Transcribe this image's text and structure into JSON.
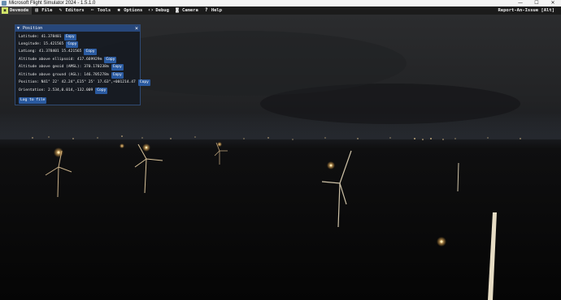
{
  "window": {
    "title": "Microsoft Flight Simulator 2024 - 1.5.1.0",
    "minimize": "—",
    "maximize": "☐",
    "close": "✕"
  },
  "menubar": {
    "items": [
      {
        "label": "Devmode",
        "icon": "devmode-icon"
      },
      {
        "label": "File",
        "icon": "file-icon"
      },
      {
        "label": "Editors",
        "icon": "pencil-icon"
      },
      {
        "label": "Tools",
        "icon": "tools-icon"
      },
      {
        "label": "Options",
        "icon": "gear-icon"
      },
      {
        "label": "Debug",
        "icon": "code-icon"
      },
      {
        "label": "Camera",
        "icon": "camera-icon"
      },
      {
        "label": "Help",
        "icon": "help-icon"
      }
    ],
    "report": "Report-An-Issue [Alt]"
  },
  "panel": {
    "title": "Position",
    "copy_label": "Copy",
    "log_label": "Log to file",
    "rows": [
      "Latitude: 41.378401",
      "Longitude: 15.421565",
      "LatLong: 41.378401 15.421565",
      "Altitude above ellipsoid: 417.669929m",
      "Altitude above geoid (AMSL): 370.170238m",
      "Altitude above ground (AGL): 146.705278m",
      "Position: N41° 22' 42.24\",E15° 25' 17.63\",+001214.47",
      "Orientation: 2.534,0.014,-132.009"
    ]
  }
}
